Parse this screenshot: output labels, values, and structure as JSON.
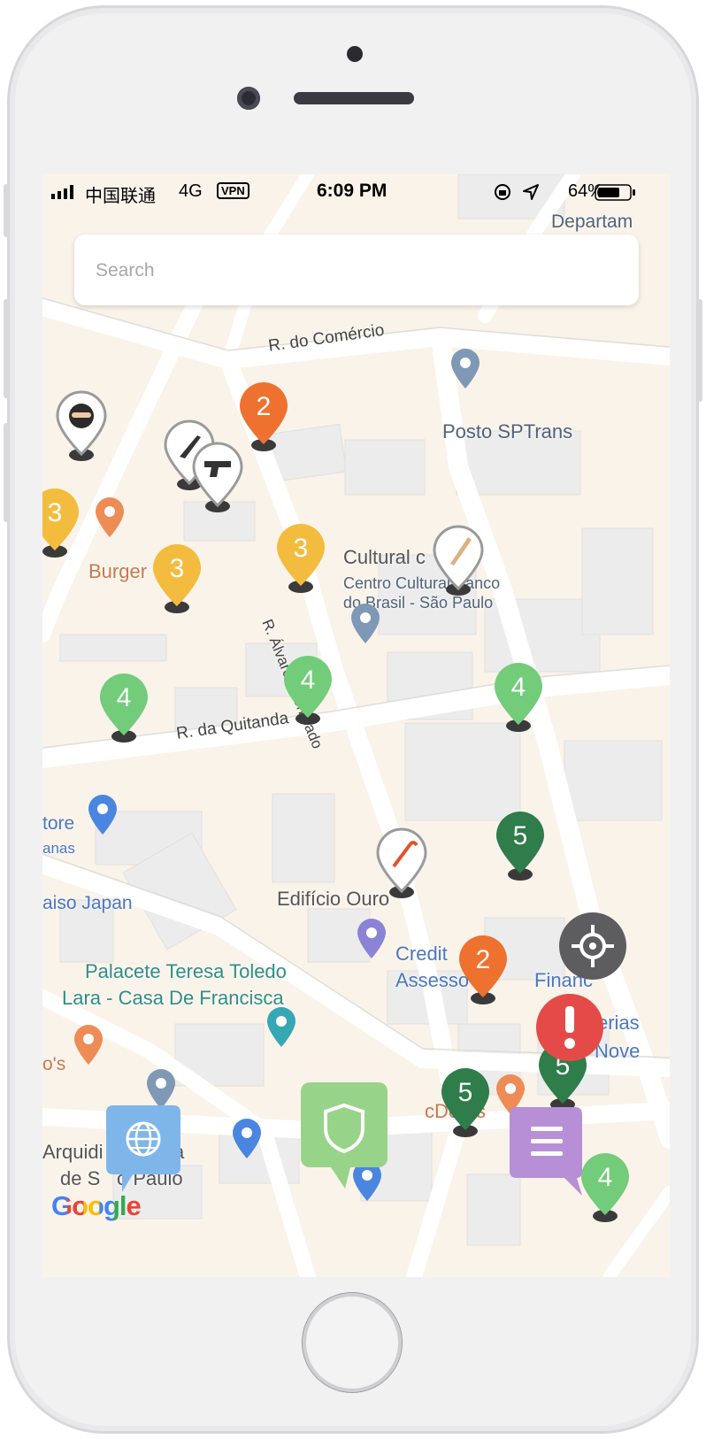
{
  "status_bar": {
    "carrier": "中国联通",
    "network": "4G",
    "vpn": "VPN",
    "time": "6:09 PM",
    "battery_percent": "64%"
  },
  "search": {
    "placeholder": "Search",
    "value": ""
  },
  "map": {
    "street_labels": [
      "R. do Comércio",
      "R. da Quitanda",
      "R. Álvares Penteado"
    ],
    "place_labels": [
      "Departam",
      "Posto SPTrans",
      "Cultural c",
      "Centro Cultural Banco",
      "do Brasil - São Paulo",
      "Burger",
      "tore",
      "anas",
      "aiso Japan",
      "Edifício Ouro",
      "Credit",
      "Assesso",
      "Financ",
      "Palacete Teresa Toledo",
      "Lara - Casa De Francisca",
      "o's",
      "cDona",
      "s",
      "erias",
      "Nove",
      "Arquidi",
      "a",
      "de S",
      "o Paulo"
    ],
    "attribution": "Google",
    "count_markers": [
      {
        "count": "2",
        "color": "#ee7130"
      },
      {
        "count": "3",
        "color": "#f3bc3e"
      },
      {
        "count": "3",
        "color": "#f3bc3e"
      },
      {
        "count": "3",
        "color": "#f3bc3e"
      },
      {
        "count": "4",
        "color": "#72cc7a"
      },
      {
        "count": "4",
        "color": "#72cc7a"
      },
      {
        "count": "4",
        "color": "#72cc7a"
      },
      {
        "count": "5",
        "color": "#2e7d4a"
      },
      {
        "count": "2",
        "color": "#ee7130"
      },
      {
        "count": "5",
        "color": "#2e7d4a"
      },
      {
        "count": "5",
        "color": "#2e7d4a"
      },
      {
        "count": "4",
        "color": "#72cc7a"
      }
    ],
    "incident_markers": [
      "thief-icon",
      "knife-icon",
      "gun-icon",
      "bat-icon",
      "crowbar-icon"
    ]
  },
  "buttons": {
    "globe": "globe-icon",
    "shield": "shield-icon",
    "menu": "menu-icon",
    "locate": "crosshair-icon",
    "alert": "alert-icon"
  },
  "colors": {
    "map_bg": "#faf3ea",
    "road": "#ffffff",
    "globe_btn": "#7fb6ea",
    "shield_btn": "#98d38a",
    "menu_btn": "#b78fd6",
    "locate_btn": "#5d5d5f",
    "alert_btn": "#e44b48"
  }
}
